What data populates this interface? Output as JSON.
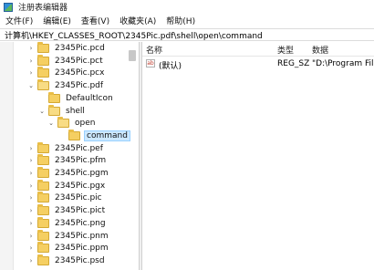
{
  "window": {
    "title": "注册表编辑器"
  },
  "menu": [
    "文件(F)",
    "编辑(E)",
    "查看(V)",
    "收藏夹(A)",
    "帮助(H)"
  ],
  "address": "计算机\\HKEY_CLASSES_ROOT\\2345Pic.pdf\\shell\\open\\command",
  "tree": [
    {
      "label": "2345Pic.pcd",
      "expander": ">"
    },
    {
      "label": "2345Pic.pct",
      "expander": ">"
    },
    {
      "label": "2345Pic.pcx",
      "expander": ">"
    },
    {
      "label": "2345Pic.pdf",
      "expander": "v"
    },
    {
      "label": "DefaultIcon",
      "expander": ""
    },
    {
      "label": "shell",
      "expander": "v"
    },
    {
      "label": "open",
      "expander": "v"
    },
    {
      "label": "command",
      "expander": "",
      "selected": true
    },
    {
      "label": "2345Pic.pef",
      "expander": ">"
    },
    {
      "label": "2345Pic.pfm",
      "expander": ">"
    },
    {
      "label": "2345Pic.pgm",
      "expander": ">"
    },
    {
      "label": "2345Pic.pgx",
      "expander": ">"
    },
    {
      "label": "2345Pic.pic",
      "expander": ">"
    },
    {
      "label": "2345Pic.pict",
      "expander": ">"
    },
    {
      "label": "2345Pic.png",
      "expander": ">"
    },
    {
      "label": "2345Pic.pnm",
      "expander": ">"
    },
    {
      "label": "2345Pic.ppm",
      "expander": ">"
    },
    {
      "label": "2345Pic.psd",
      "expander": ">"
    }
  ],
  "list": {
    "headers": {
      "name": "名称",
      "type": "类型",
      "data": "数据"
    },
    "rows": [
      {
        "icon": "ab",
        "name": "(默认)",
        "type": "REG_SZ",
        "data": "\"D:\\Program Files"
      }
    ]
  }
}
